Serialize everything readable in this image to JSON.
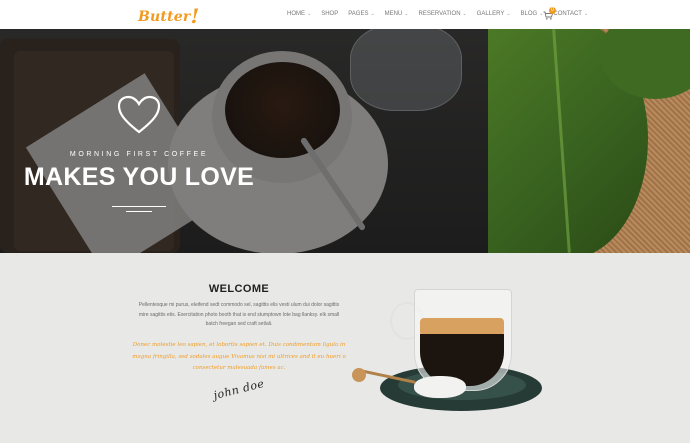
{
  "header": {
    "logo": {
      "text": "Butter",
      "mark": "!"
    },
    "nav": [
      {
        "label": "HOME",
        "dropdown": true
      },
      {
        "label": "SHOP",
        "dropdown": false
      },
      {
        "label": "PAGES",
        "dropdown": true
      },
      {
        "label": "MENU",
        "dropdown": true
      },
      {
        "label": "RESERVATION",
        "dropdown": true
      },
      {
        "label": "GALLERY",
        "dropdown": true
      },
      {
        "label": "BLOG",
        "dropdown": true
      },
      {
        "label": "CONTACT",
        "dropdown": true
      }
    ],
    "cart": {
      "icon": "shopping-cart-icon",
      "count": "0"
    }
  },
  "hero": {
    "icon": "heart-icon",
    "subtitle": "MORNING FIRST COFFEE",
    "title": "MAKES YOU LOVE"
  },
  "welcome": {
    "title": "WELCOME",
    "body": "Pellentesque mi purus, eleifend sedt commodo sel, sagittis elis vesti ulum dui dolor sagittis mire sagittis etis. Exercitation photo booth that is end stumptown lote bag llanksy. elk small batch freegan sed craft setlali.",
    "quote": "Donec molestie leo sapien, et lobortis sapien et. Duis condimentum ligula in magna fringilla, sed sodales augue Vivamus nisi mi ultrices and it eu hueri o consectetur malesuada fames ac.",
    "signature": "john doe"
  },
  "colors": {
    "accent": "#f29a1f",
    "section_bg": "#e8e9e7",
    "text_dark": "#1f1f1f"
  }
}
